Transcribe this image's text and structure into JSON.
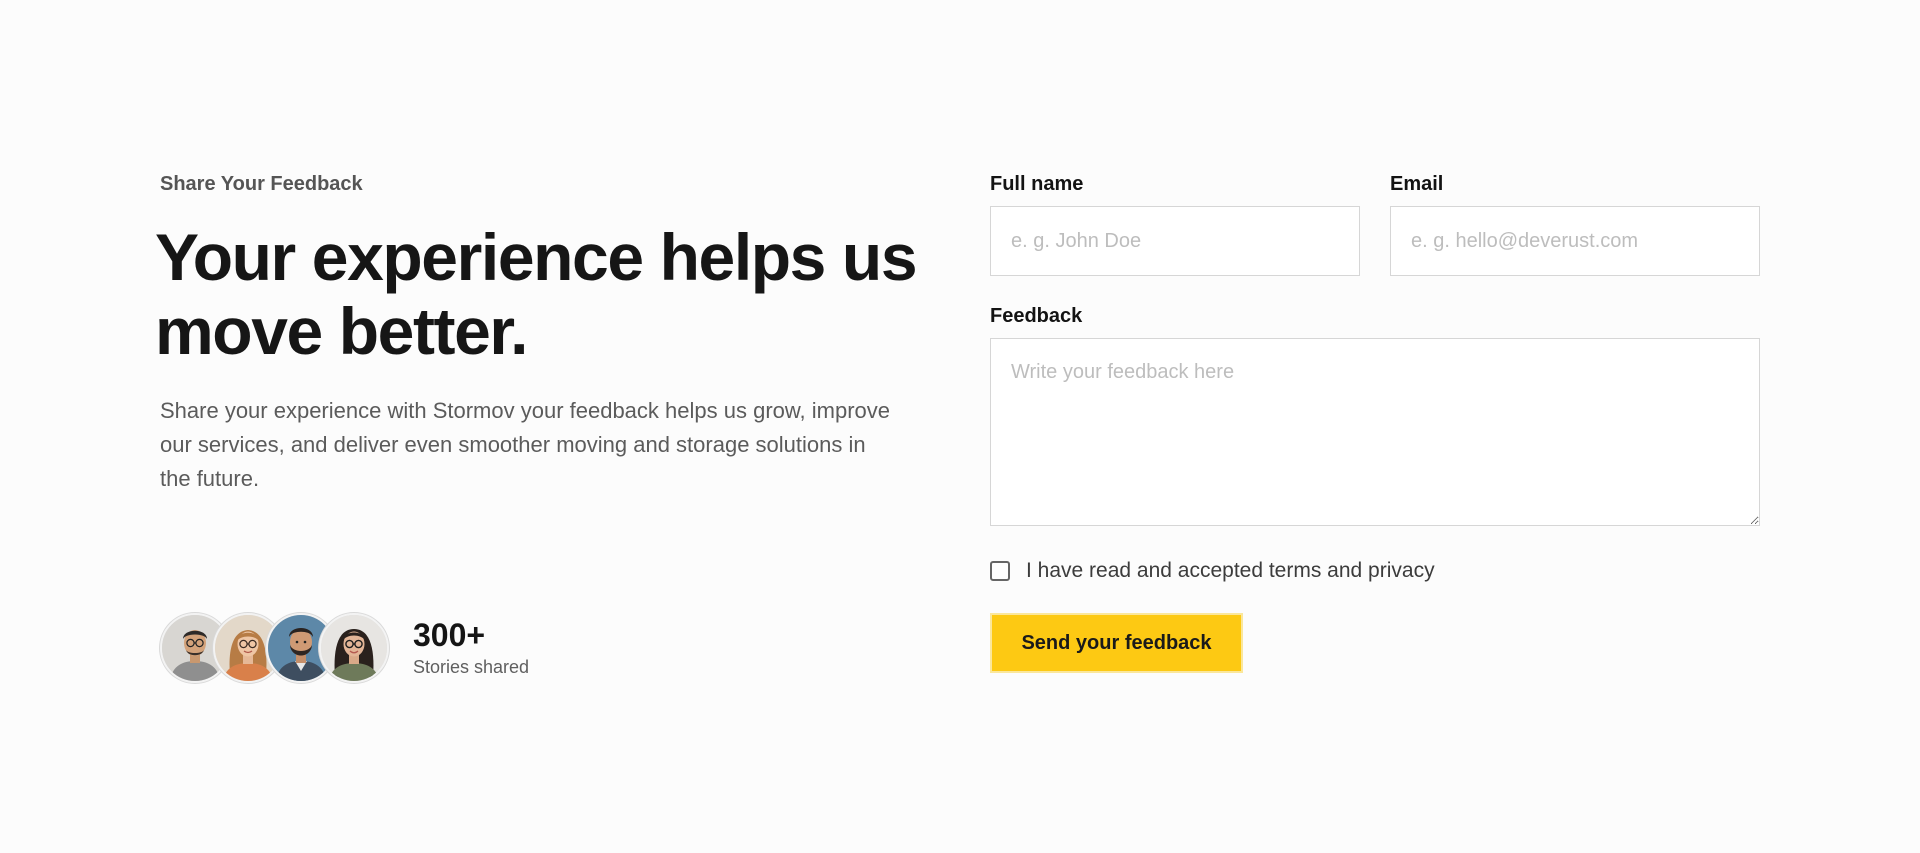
{
  "hero": {
    "eyebrow": "Share Your Feedback",
    "headline_line1": "Your experience helps us",
    "headline_line2": "move better.",
    "subtitle": "Share your experience with Stormov your feedback helps us grow, improve our services, and deliver even smoother moving and storage solutions in the future."
  },
  "social_proof": {
    "avatars": [
      "avatar-man-glasses",
      "avatar-woman-glasses",
      "avatar-man-beard",
      "avatar-woman-dark-hair"
    ],
    "count": "300+",
    "label": "Stories shared"
  },
  "form": {
    "full_name": {
      "label": "Full name",
      "placeholder": "e. g. John Doe",
      "value": ""
    },
    "email": {
      "label": "Email",
      "placeholder": "e. g. hello@deverust.com",
      "value": ""
    },
    "feedback": {
      "label": "Feedback",
      "placeholder": "Write your feedback here",
      "value": ""
    },
    "terms_label": "I have read and accepted terms and privacy",
    "terms_checked": false,
    "submit_label": "Send your feedback"
  },
  "colors": {
    "accent": "#fdc913",
    "background": "#fcfcfc",
    "heading": "#161616",
    "muted_text": "#5b5b5b"
  }
}
